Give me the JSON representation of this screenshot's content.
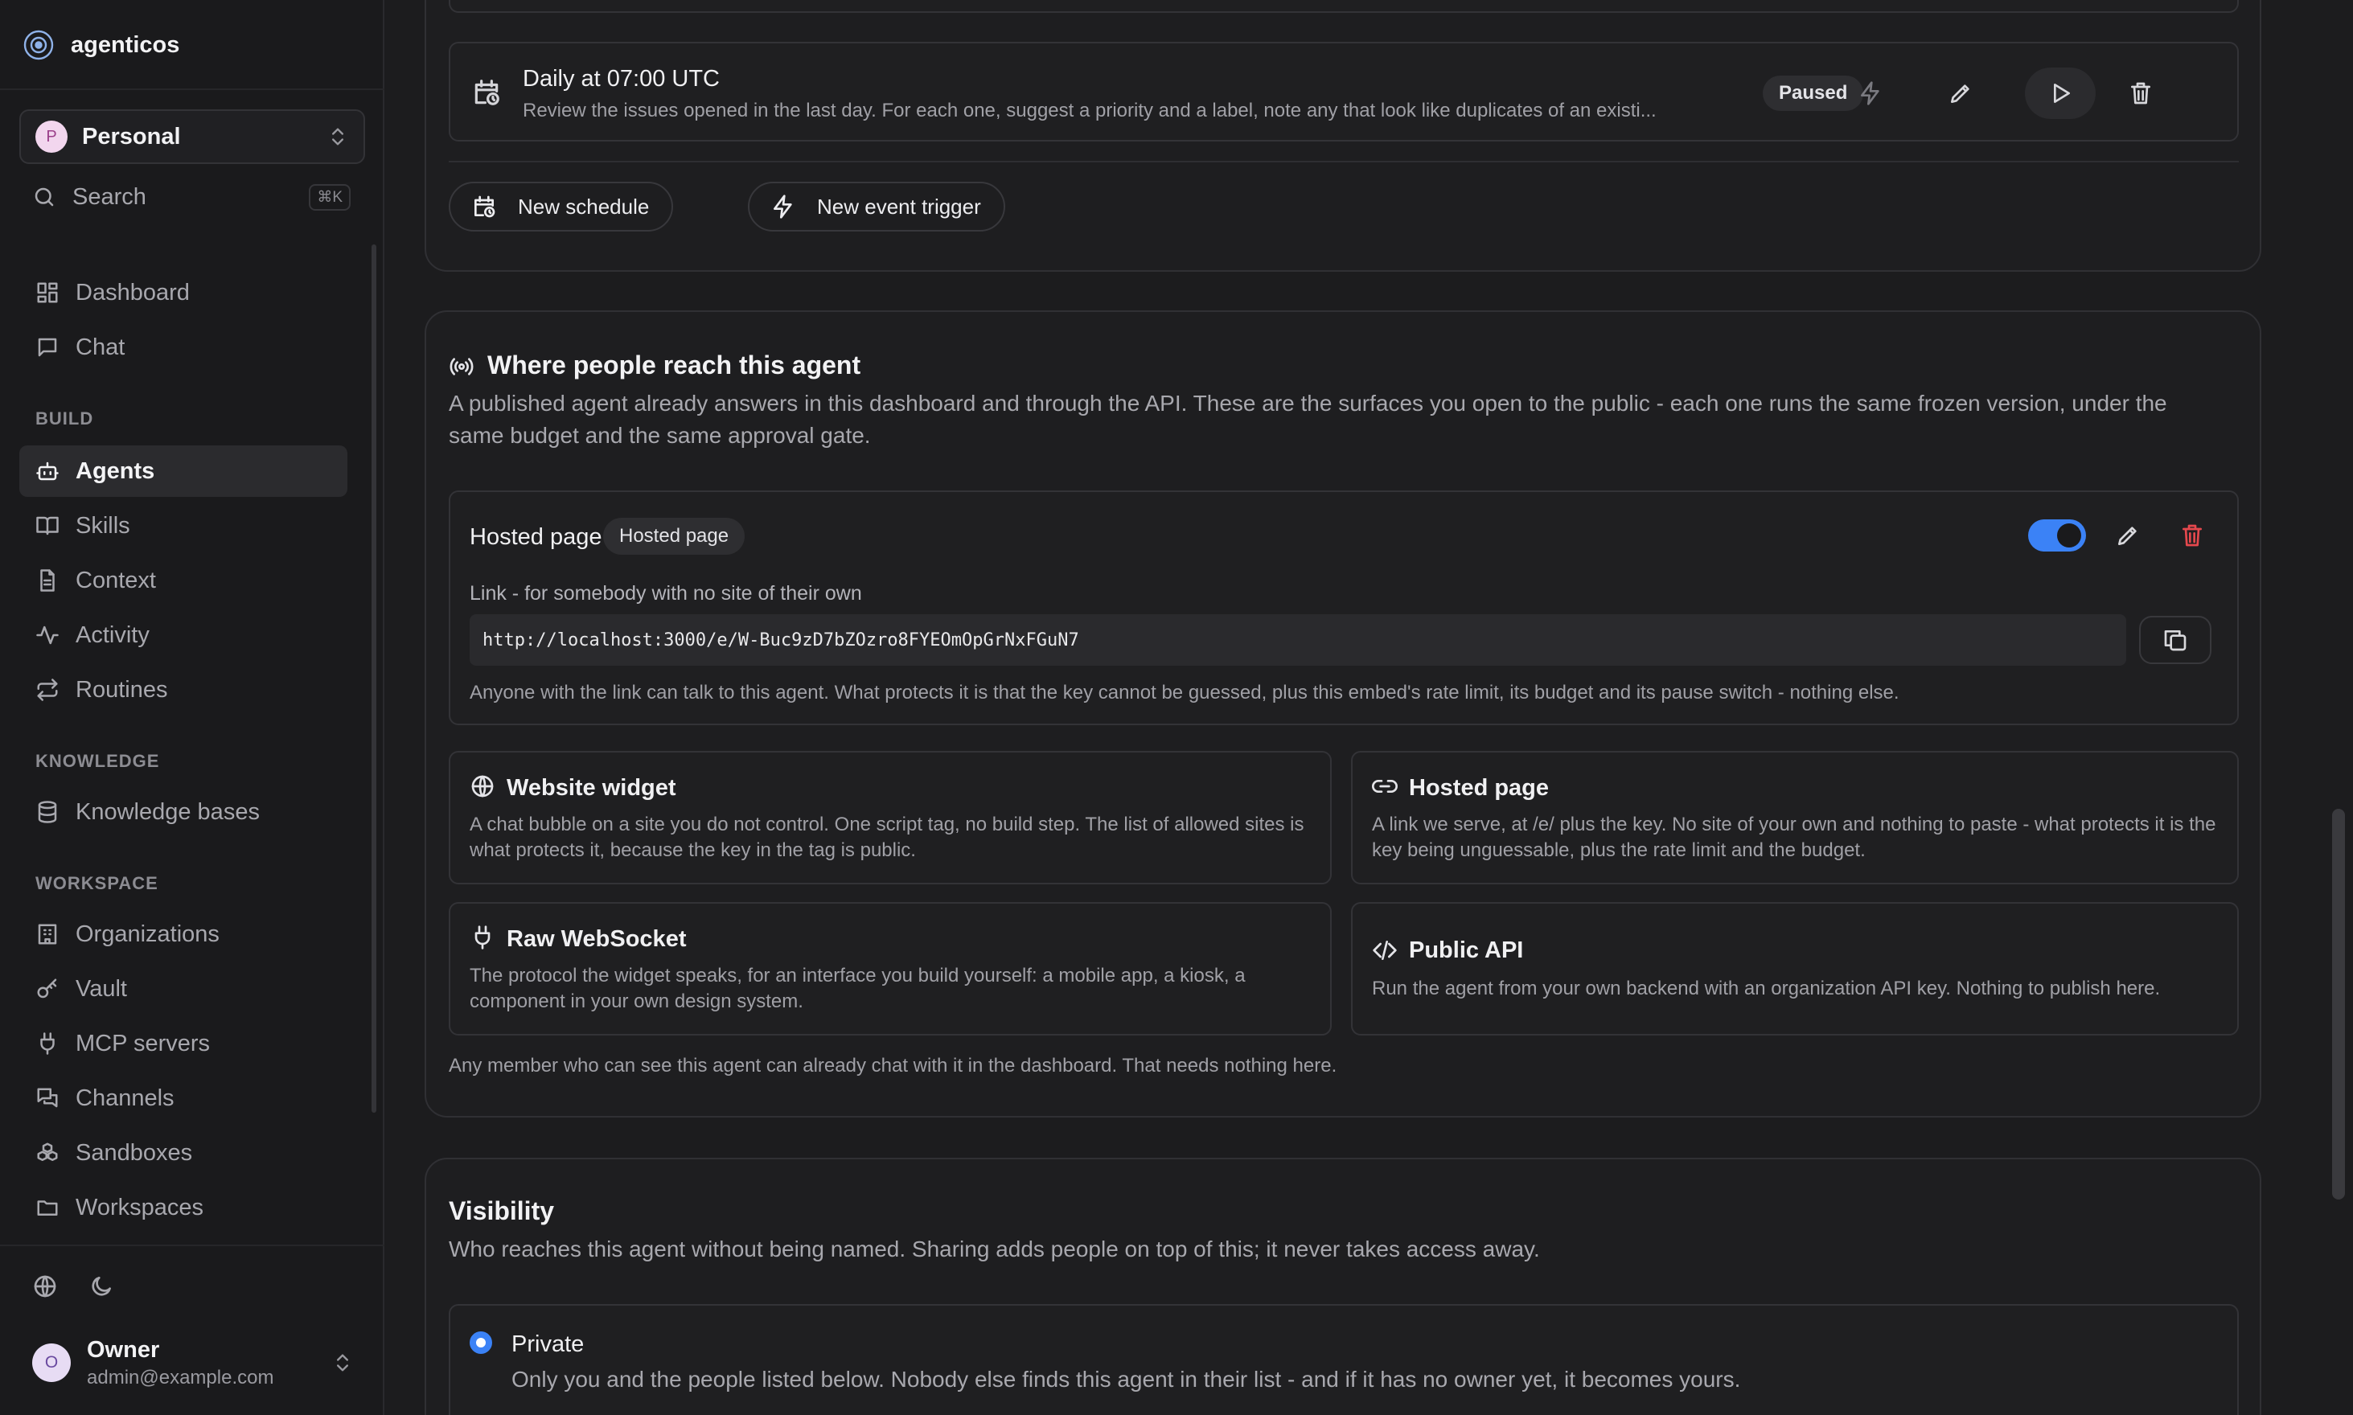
{
  "app": {
    "name": "agenticos"
  },
  "workspace": {
    "avatar": "P",
    "name": "Personal"
  },
  "search": {
    "label": "Search",
    "shortcut": "⌘K"
  },
  "nav_top": [
    {
      "label": "Dashboard",
      "icon": "dashboard-icon"
    },
    {
      "label": "Chat",
      "icon": "chat-icon"
    }
  ],
  "sections": {
    "build": "BUILD",
    "knowledge": "KNOWLEDGE",
    "workspace": "WORKSPACE"
  },
  "nav_build": [
    {
      "label": "Agents",
      "icon": "bot-icon",
      "active": true
    },
    {
      "label": "Skills",
      "icon": "book-icon"
    },
    {
      "label": "Context",
      "icon": "document-icon"
    },
    {
      "label": "Activity",
      "icon": "activity-icon"
    },
    {
      "label": "Routines",
      "icon": "repeat-icon"
    }
  ],
  "nav_knowledge": [
    {
      "label": "Knowledge bases",
      "icon": "database-icon"
    }
  ],
  "nav_workspace": [
    {
      "label": "Organizations",
      "icon": "building-icon"
    },
    {
      "label": "Vault",
      "icon": "key-icon"
    },
    {
      "label": "MCP servers",
      "icon": "plug-icon"
    },
    {
      "label": "Channels",
      "icon": "messages-icon"
    },
    {
      "label": "Sandboxes",
      "icon": "boxes-icon"
    },
    {
      "label": "Workspaces",
      "icon": "folder-icon"
    }
  ],
  "user": {
    "avatar": "O",
    "name": "Owner",
    "email": "admin@example.com"
  },
  "schedule": {
    "title": "Daily at 07:00 UTC",
    "description": "Review the issues opened in the last day. For each one, suggest a priority and a label, note any that look like duplicates of an existi...",
    "status": "Paused",
    "new_schedule": "New schedule",
    "new_event_trigger": "New event trigger"
  },
  "reach": {
    "title": "Where people reach this agent",
    "description": "A published agent already answers in this dashboard and through the API. These are the surfaces you open to the public - each one runs the same frozen version, under the same budget and the same approval gate.",
    "hosted": {
      "title": "Hosted page",
      "badge": "Hosted page",
      "enabled": true,
      "link_label": "Link - for somebody with no site of their own",
      "url": "http://localhost:3000/e/W-Buc9zD7bZOzro8FYEOmOpGrNxFGuN7",
      "note": "Anyone with the link can talk to this agent. What protects it is that the key cannot be guessed, plus this embed's rate limit, its budget and its pause switch - nothing else."
    },
    "options": [
      {
        "title": "Website widget",
        "icon": "globe-icon",
        "description": "A chat bubble on a site you do not control. One script tag, no build step. The list of allowed sites is what protects it, because the key in the tag is public."
      },
      {
        "title": "Hosted page",
        "icon": "link-icon",
        "description": "A link we serve, at /e/ plus the key. No site of your own and nothing to paste - what protects it is the key being unguessable, plus the rate limit and the budget."
      },
      {
        "title": "Raw WebSocket",
        "icon": "plug-icon",
        "description": "The protocol the widget speaks, for an interface you build yourself: a mobile app, a kiosk, a component in your own design system."
      },
      {
        "title": "Public API",
        "icon": "code-icon",
        "description": "Run the agent from your own backend with an organization API key. Nothing to publish here."
      }
    ],
    "footer": "Any member who can see this agent can already chat with it in the dashboard. That needs nothing here."
  },
  "visibility": {
    "title": "Visibility",
    "description": "Who reaches this agent without being named. Sharing adds people on top of this; it never takes access away.",
    "options": [
      {
        "title": "Private",
        "selected": true,
        "description": "Only you and the people listed below. Nobody else finds this agent in their list - and if it has no owner yet, it becomes yours."
      }
    ]
  },
  "colors": {
    "accent": "#3b82f6",
    "danger": "#e5484d",
    "bg": "#1c1c1e",
    "card": "#1e1e20"
  }
}
